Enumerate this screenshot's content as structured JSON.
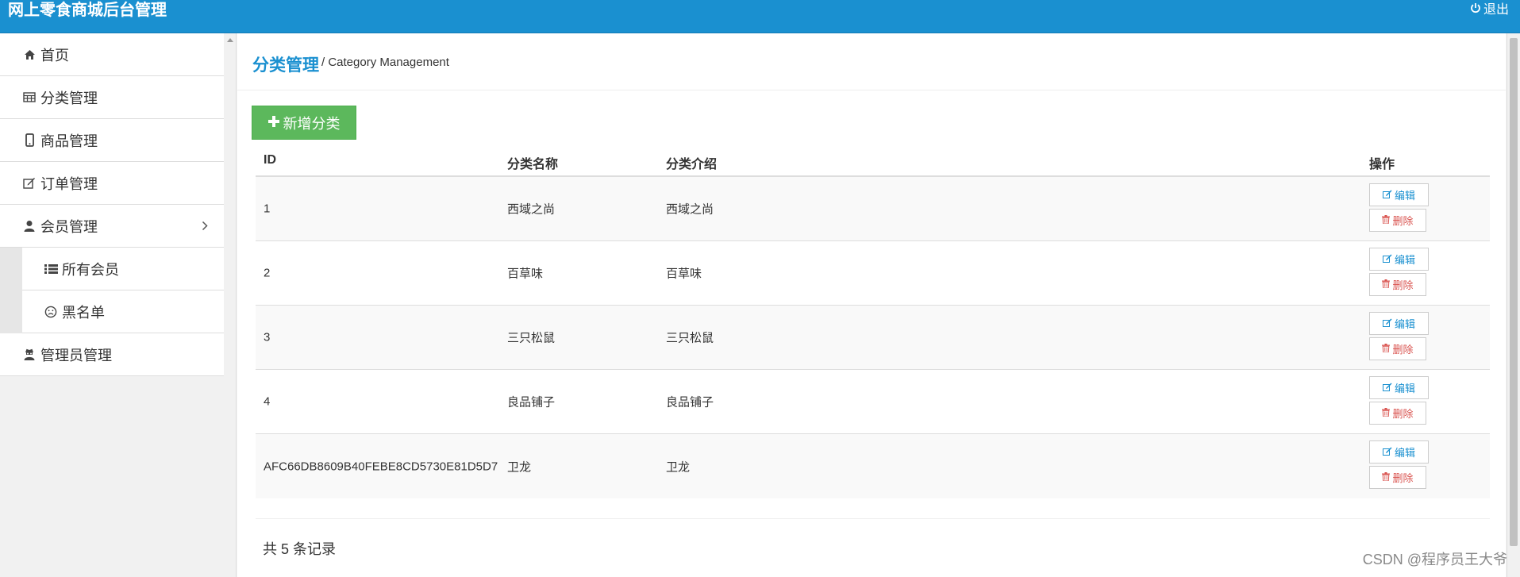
{
  "header": {
    "brand": "网上零食商城后台管理",
    "logout_label": "退出",
    "logout_icon": "power-icon"
  },
  "sidebar": {
    "items": [
      {
        "label": "首页",
        "icon": "home-icon"
      },
      {
        "label": "分类管理",
        "icon": "table-icon"
      },
      {
        "label": "商品管理",
        "icon": "mobile-icon"
      },
      {
        "label": "订单管理",
        "icon": "edit-icon"
      },
      {
        "label": "会员管理",
        "icon": "user-icon",
        "expanded": true
      },
      {
        "label": "所有会员",
        "icon": "list-icon",
        "sub": true
      },
      {
        "label": "黑名单",
        "icon": "frown-icon",
        "sub": true
      },
      {
        "label": "管理员管理",
        "icon": "user-secret-icon"
      }
    ]
  },
  "page": {
    "title": "分类管理",
    "separator": "/",
    "subtitle": "Category Management"
  },
  "add_button_label": "新增分类",
  "table": {
    "headers": {
      "id": "ID",
      "name": "分类名称",
      "desc": "分类介绍",
      "ops": "操作"
    },
    "rows": [
      {
        "id": "1",
        "name": "西域之尚",
        "desc": "西域之尚"
      },
      {
        "id": "2",
        "name": "百草味",
        "desc": "百草味"
      },
      {
        "id": "3",
        "name": "三只松鼠",
        "desc": "三只松鼠"
      },
      {
        "id": "4",
        "name": "良品铺子",
        "desc": "良品铺子"
      },
      {
        "id": "AFC66DB8609B40FEBE8CD5730E81D5D7",
        "name": "卫龙",
        "desc": "卫龙"
      }
    ],
    "edit_label": "编辑",
    "delete_label": "删除"
  },
  "records_text": "共 5 条记录",
  "watermark": "CSDN @程序员王大爷",
  "colors": {
    "primary": "#1a90d0",
    "success": "#5cb85c",
    "danger": "#d9534f"
  }
}
